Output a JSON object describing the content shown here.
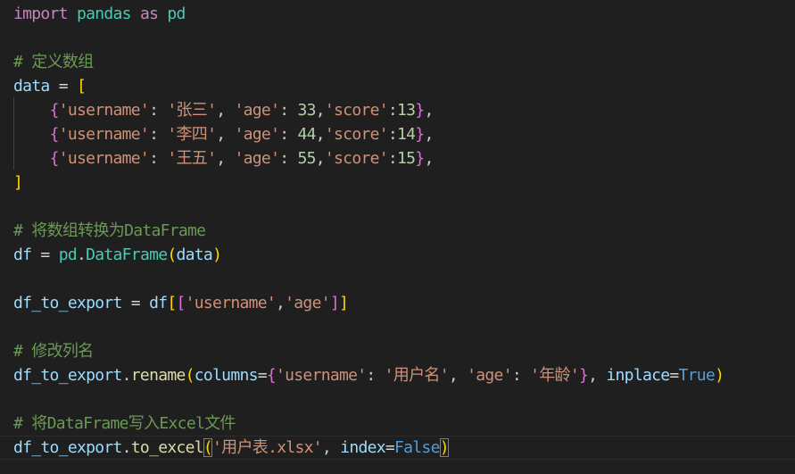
{
  "editor": {
    "language": "python",
    "theme": "dark",
    "lines": [
      [
        {
          "t": "import",
          "c": "kw"
        },
        {
          "t": " "
        },
        {
          "t": "pandas",
          "c": "cls"
        },
        {
          "t": " "
        },
        {
          "t": "as",
          "c": "kw"
        },
        {
          "t": " "
        },
        {
          "t": "pd",
          "c": "cls"
        }
      ],
      [],
      [
        {
          "t": "# 定义数组",
          "c": "com"
        }
      ],
      [
        {
          "t": "data",
          "c": "id"
        },
        {
          "t": " "
        },
        {
          "t": "=",
          "c": "op"
        },
        {
          "t": " "
        },
        {
          "t": "[",
          "c": "b1"
        }
      ],
      [
        {
          "t": "    "
        },
        {
          "t": "{",
          "c": "b2"
        },
        {
          "t": "'username'",
          "c": "str"
        },
        {
          "t": ": "
        },
        {
          "t": "'张三'",
          "c": "str"
        },
        {
          "t": ", "
        },
        {
          "t": "'age'",
          "c": "str"
        },
        {
          "t": ": "
        },
        {
          "t": "33",
          "c": "num"
        },
        {
          "t": ","
        },
        {
          "t": "'score'",
          "c": "str"
        },
        {
          "t": ":"
        },
        {
          "t": "13",
          "c": "num"
        },
        {
          "t": "}",
          "c": "b2"
        },
        {
          "t": ","
        }
      ],
      [
        {
          "t": "    "
        },
        {
          "t": "{",
          "c": "b2"
        },
        {
          "t": "'username'",
          "c": "str"
        },
        {
          "t": ": "
        },
        {
          "t": "'李四'",
          "c": "str"
        },
        {
          "t": ", "
        },
        {
          "t": "'age'",
          "c": "str"
        },
        {
          "t": ": "
        },
        {
          "t": "44",
          "c": "num"
        },
        {
          "t": ","
        },
        {
          "t": "'score'",
          "c": "str"
        },
        {
          "t": ":"
        },
        {
          "t": "14",
          "c": "num"
        },
        {
          "t": "}",
          "c": "b2"
        },
        {
          "t": ","
        }
      ],
      [
        {
          "t": "    "
        },
        {
          "t": "{",
          "c": "b2"
        },
        {
          "t": "'username'",
          "c": "str"
        },
        {
          "t": ": "
        },
        {
          "t": "'王五'",
          "c": "str"
        },
        {
          "t": ", "
        },
        {
          "t": "'age'",
          "c": "str"
        },
        {
          "t": ": "
        },
        {
          "t": "55",
          "c": "num"
        },
        {
          "t": ","
        },
        {
          "t": "'score'",
          "c": "str"
        },
        {
          "t": ":"
        },
        {
          "t": "15",
          "c": "num"
        },
        {
          "t": "}",
          "c": "b2"
        },
        {
          "t": ","
        }
      ],
      [
        {
          "t": "]",
          "c": "b1"
        }
      ],
      [],
      [
        {
          "t": "# 将数组转换为DataFrame",
          "c": "com"
        }
      ],
      [
        {
          "t": "df",
          "c": "id"
        },
        {
          "t": " "
        },
        {
          "t": "=",
          "c": "op"
        },
        {
          "t": " "
        },
        {
          "t": "pd",
          "c": "cls"
        },
        {
          "t": "."
        },
        {
          "t": "DataFrame",
          "c": "cls"
        },
        {
          "t": "(",
          "c": "b1"
        },
        {
          "t": "data",
          "c": "id"
        },
        {
          "t": ")",
          "c": "b1"
        }
      ],
      [],
      [
        {
          "t": "df_to_export",
          "c": "id"
        },
        {
          "t": " "
        },
        {
          "t": "=",
          "c": "op"
        },
        {
          "t": " "
        },
        {
          "t": "df",
          "c": "id"
        },
        {
          "t": "[",
          "c": "b1"
        },
        {
          "t": "[",
          "c": "b2"
        },
        {
          "t": "'username'",
          "c": "str"
        },
        {
          "t": ","
        },
        {
          "t": "'age'",
          "c": "str"
        },
        {
          "t": "]",
          "c": "b2"
        },
        {
          "t": "]",
          "c": "b1"
        }
      ],
      [],
      [
        {
          "t": "# 修改列名",
          "c": "com"
        }
      ],
      [
        {
          "t": "df_to_export",
          "c": "id"
        },
        {
          "t": "."
        },
        {
          "t": "rename",
          "c": "fn"
        },
        {
          "t": "(",
          "c": "b1"
        },
        {
          "t": "columns",
          "c": "id"
        },
        {
          "t": "=",
          "c": "op"
        },
        {
          "t": "{",
          "c": "b2"
        },
        {
          "t": "'username'",
          "c": "str"
        },
        {
          "t": ": "
        },
        {
          "t": "'用户名'",
          "c": "str"
        },
        {
          "t": ", "
        },
        {
          "t": "'age'",
          "c": "str"
        },
        {
          "t": ": "
        },
        {
          "t": "'年龄'",
          "c": "str"
        },
        {
          "t": "}",
          "c": "b2"
        },
        {
          "t": ", "
        },
        {
          "t": "inplace",
          "c": "id"
        },
        {
          "t": "=",
          "c": "op"
        },
        {
          "t": "True",
          "c": "kwb"
        },
        {
          "t": ")",
          "c": "b1"
        }
      ],
      [],
      [
        {
          "t": "# 将DataFrame写入Excel文件",
          "c": "com"
        }
      ],
      [
        {
          "t": "df_to_export",
          "c": "id"
        },
        {
          "t": "."
        },
        {
          "t": "to_excel",
          "c": "fn"
        },
        {
          "t": "(",
          "c": "b1",
          "m": 1
        },
        {
          "t": "'用户表.xlsx'",
          "c": "str"
        },
        {
          "t": ", "
        },
        {
          "t": "index",
          "c": "id"
        },
        {
          "t": "=",
          "c": "op"
        },
        {
          "t": "False",
          "c": "kwb"
        },
        {
          "t": ")",
          "c": "b1",
          "m": 1
        }
      ]
    ]
  }
}
